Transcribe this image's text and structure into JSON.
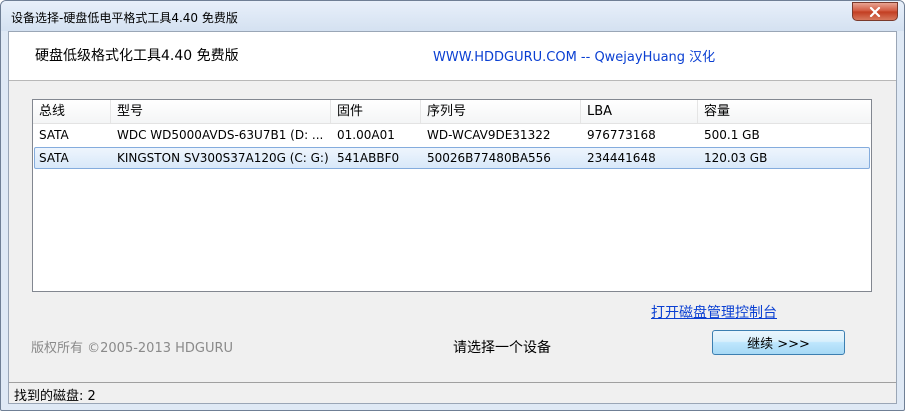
{
  "window": {
    "title": "设备选择-硬盘低电平格式工具4.40    免费版"
  },
  "header": {
    "heading": "硬盘低级格式化工具4.40   免费版",
    "credit": "WWW.HDDGURU.COM -- QwejayHuang 汉化"
  },
  "device_list": {
    "columns": [
      "总线",
      "型号",
      "固件",
      "序列号",
      "LBA",
      "容量"
    ],
    "rows": [
      {
        "bus": "SATA",
        "model": "WDC WD5000AVDS-63U7B1 (D: ...",
        "firmware": "01.00A01",
        "serial": "WD-WCAV9DE31322",
        "lba": "976773168",
        "capacity": "500.1 GB",
        "selected": false
      },
      {
        "bus": "SATA",
        "model": "KINGSTON SV300S37A120G (C: G:)",
        "firmware": "541ABBF0",
        "serial": "50026B77480BA556",
        "lba": "234441648",
        "capacity": "120.03 GB",
        "selected": true
      }
    ]
  },
  "footer": {
    "disk_mgmt_link": "打开磁盘管理控制台",
    "copyright": "版权所有 ©2005-2013 HDGURU",
    "prompt": "请选择一个设备",
    "continue_label": "继续 >>>"
  },
  "status": {
    "text": "找到的磁盘: 2"
  },
  "colors": {
    "link": "#0a3fd2",
    "selection_border": "#84acdd"
  },
  "icons": [
    "close-icon"
  ]
}
